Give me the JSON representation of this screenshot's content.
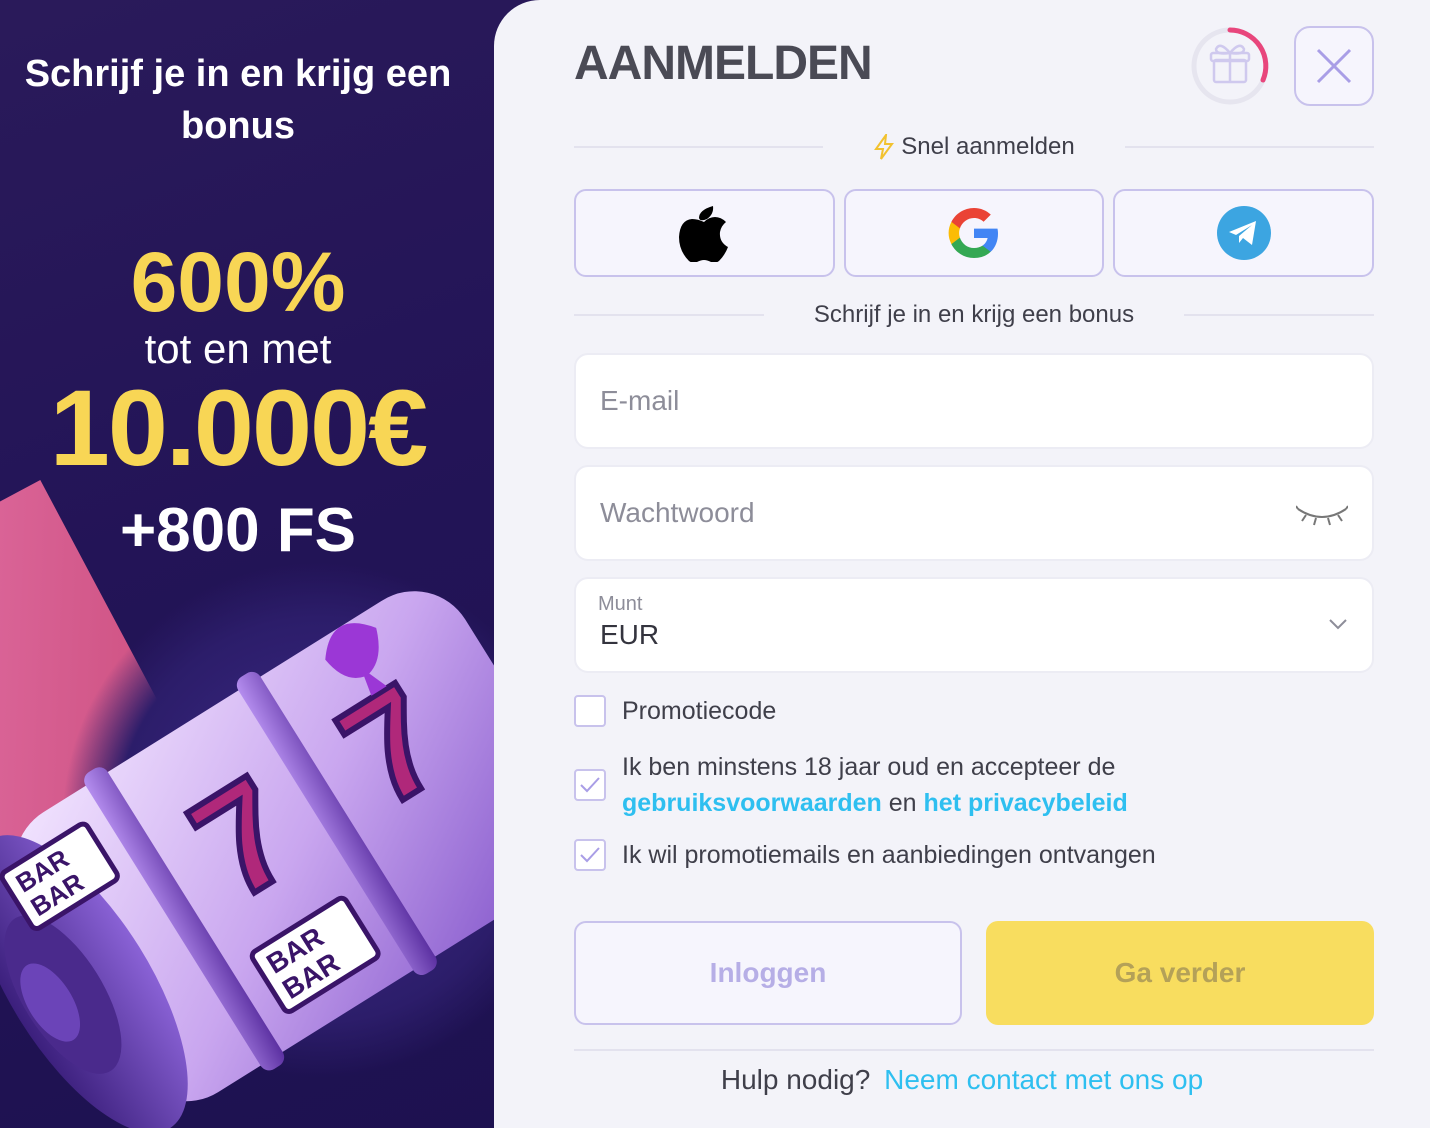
{
  "promo": {
    "title": "Schrijf je in en krijg een bonus",
    "percent": "600%",
    "up_to": "tot en met",
    "amount": "10.000€",
    "free_spins": "+800 FS"
  },
  "modal": {
    "heading": "AANMELDEN",
    "quick_signup_label": "Snel aanmelden",
    "social_buttons": [
      "apple-icon",
      "google-icon",
      "telegram-icon"
    ],
    "signup_bonus_label": "Schrijf je in en krijg een bonus",
    "email": {
      "placeholder": "E-mail",
      "value": ""
    },
    "password": {
      "placeholder": "Wachtwoord",
      "value": ""
    },
    "currency": {
      "label": "Munt",
      "value": "EUR"
    },
    "promo_code": {
      "label": "Promotiecode",
      "checked": false
    },
    "terms": {
      "text_before": "Ik ben minstens 18 jaar oud en accepteer de ",
      "terms_link": "gebruiksvoorwaarden",
      "text_middle": " en ",
      "privacy_link": "het privacybeleid",
      "checked": true
    },
    "promo_emails": {
      "label": "Ik wil promotiemails en aanbiedingen ontvangen",
      "checked": true
    },
    "login_button": "Inloggen",
    "continue_button": "Ga verder",
    "help_text": "Hulp nodig?",
    "help_link": "Neem contact met ons op"
  },
  "colors": {
    "accent_yellow": "#f8d655",
    "link_blue": "#2ebff0",
    "border_lavender": "#c8c2ec",
    "promo_bg": "#231457",
    "gift_progress": "#e8467c"
  }
}
